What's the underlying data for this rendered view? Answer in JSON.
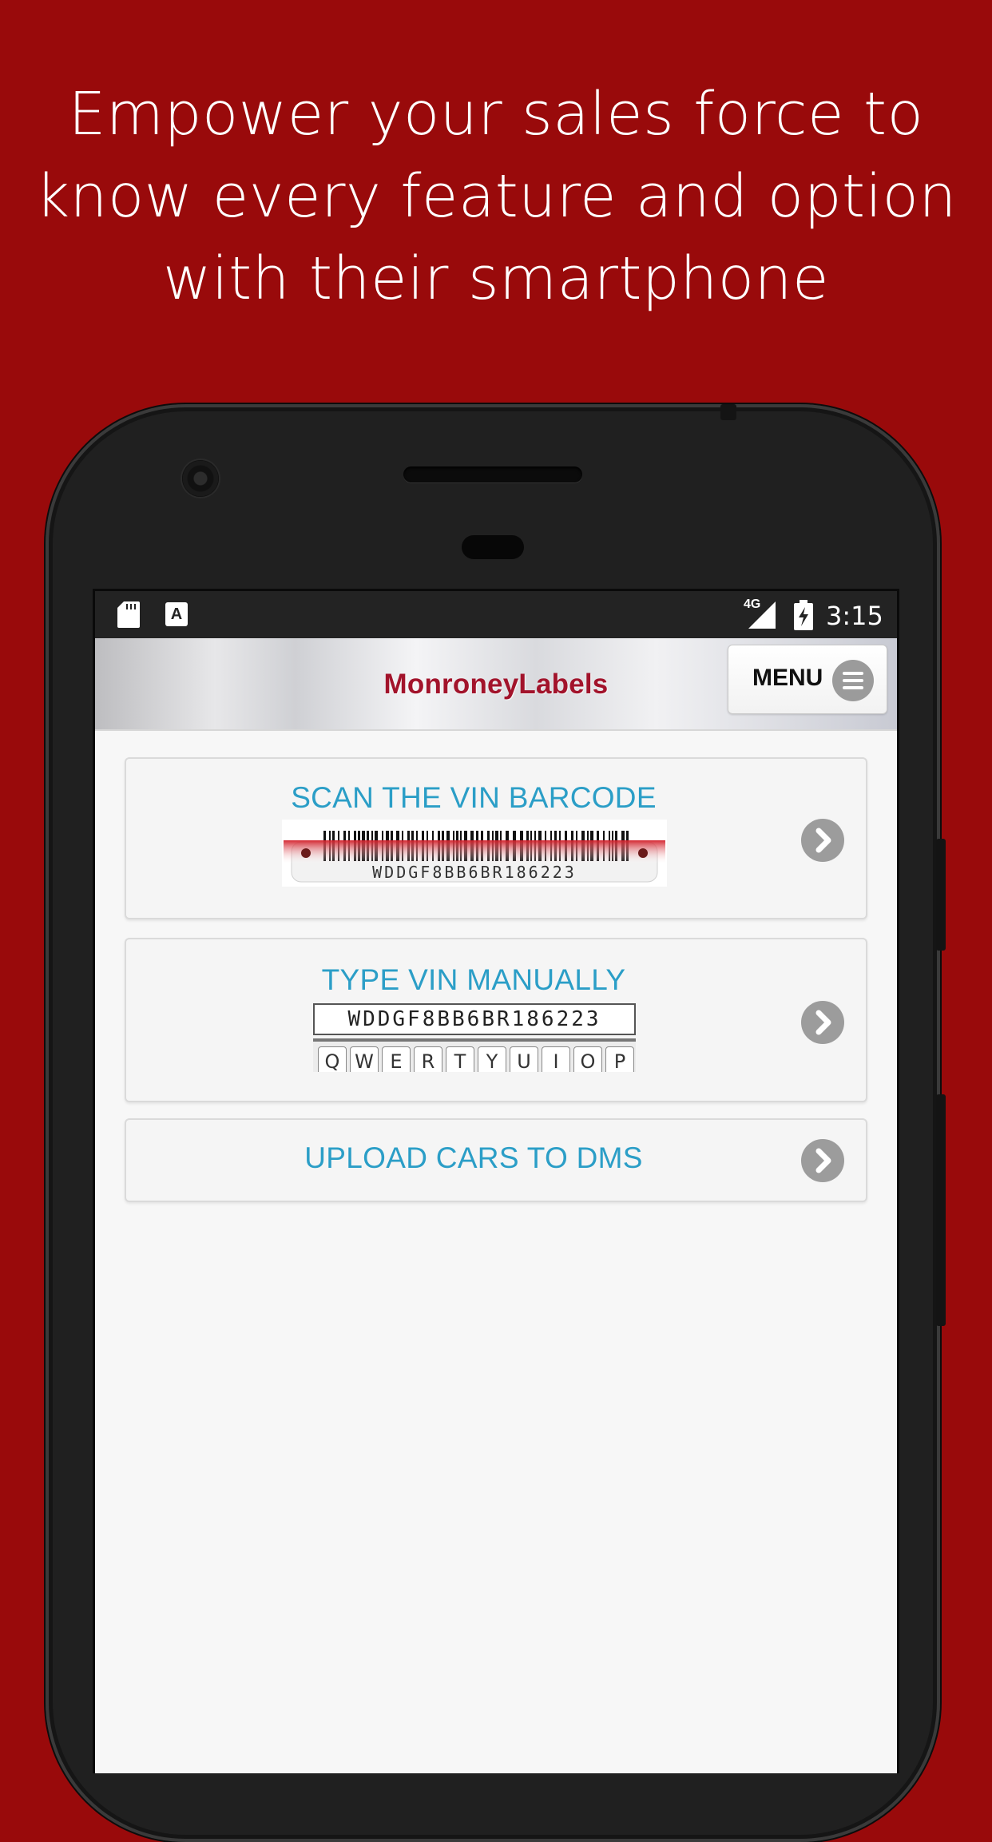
{
  "promo": {
    "line1": "Empower your sales force to",
    "line2": "know every feature and option",
    "line3": "with their smartphone"
  },
  "status_bar": {
    "network": "4G",
    "time": "3:15"
  },
  "app_bar": {
    "brand": "MonroneyLabels",
    "menu_label": "MENU"
  },
  "options": [
    {
      "label": "SCAN THE VIN BARCODE",
      "image_vin": "WDDGF8BB6BR186223"
    },
    {
      "label": "TYPE VIN MANUALLY",
      "image_vin": "WDDGF8BB6BR186223",
      "keys": [
        "Q",
        "W",
        "E",
        "R",
        "T",
        "Y",
        "U",
        "I",
        "O",
        "P"
      ]
    },
    {
      "label": "UPLOAD CARS TO DMS"
    }
  ],
  "colors": {
    "background": "#990a0b",
    "brand": "#a2132b",
    "option_text": "#2b9ec7",
    "chevron": "#9c9c9c"
  }
}
